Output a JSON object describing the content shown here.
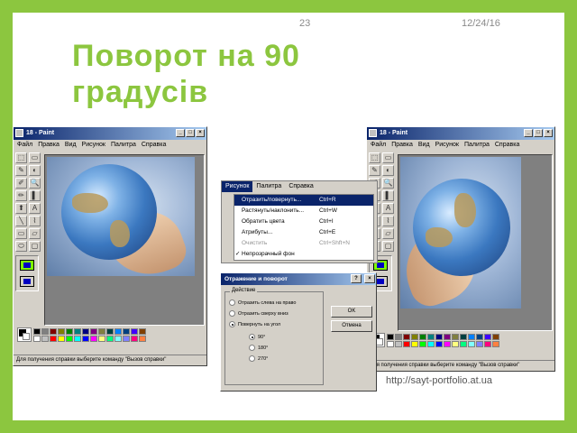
{
  "slide": {
    "number": "23",
    "date": "12/24/16",
    "title_line1": "Поворот на 90",
    "title_line2": "градусів",
    "url": "http://sayt-portfolio.at.ua"
  },
  "paint_left": {
    "title": "18 - Paint",
    "menu": [
      "Файл",
      "Правка",
      "Вид",
      "Рисунок",
      "Палитра",
      "Справка"
    ],
    "status": "Для получения справки выберите команду \"Вызов справки\""
  },
  "paint_right": {
    "title": "18 - Paint",
    "menu": [
      "Файл",
      "Правка",
      "Вид",
      "Рисунок",
      "Палитра",
      "Справка"
    ],
    "status": "Для получения справки выберите команду \"Вызов справки\""
  },
  "window_buttons": {
    "minimize": "_",
    "maximize": "□",
    "close": "×"
  },
  "tool_glyphs": [
    "⬚",
    "▭",
    "✎",
    "◐",
    "✐",
    "🔍",
    "✏",
    "▌",
    "⬆",
    "A",
    "╲",
    "⌇",
    "▭",
    "▱",
    "⬭",
    "▢"
  ],
  "palette_colors": [
    "#000000",
    "#808080",
    "#800000",
    "#808000",
    "#008000",
    "#008080",
    "#000080",
    "#800080",
    "#808040",
    "#004040",
    "#0080ff",
    "#004080",
    "#4000ff",
    "#804000",
    "#ffffff",
    "#c0c0c0",
    "#ff0000",
    "#ffff00",
    "#00ff00",
    "#00ffff",
    "#0000ff",
    "#ff00ff",
    "#ffff80",
    "#00ff80",
    "#80ffff",
    "#8080ff",
    "#ff0080",
    "#ff8040"
  ],
  "image_menu": {
    "tabs": [
      "Рисунок",
      "Палитра",
      "Справка"
    ],
    "items": [
      {
        "label": "Отразить/повернуть...",
        "shortcut": "Ctrl+R",
        "selected": true
      },
      {
        "label": "Растянуть/наклонить...",
        "shortcut": "Ctrl+W"
      },
      {
        "label": "Обратить цвета",
        "shortcut": "Ctrl+I"
      },
      {
        "label": "Атрибуты...",
        "shortcut": "Ctrl+E"
      },
      {
        "label": "Очистить",
        "shortcut": "Ctrl+Shft+N",
        "disabled": true
      },
      {
        "label": "Непрозрачный фон",
        "shortcut": "",
        "checked": true
      }
    ]
  },
  "rotate_dialog": {
    "title": "Отражение и поворот",
    "help": "?",
    "close": "×",
    "group_label": "Действие",
    "options": [
      {
        "label": "Отразить слева на право",
        "checked": false
      },
      {
        "label": "Отразить сверху вниз",
        "checked": false
      },
      {
        "label": "Повернуть на угол",
        "checked": true
      }
    ],
    "angles": [
      {
        "label": "90°",
        "checked": true
      },
      {
        "label": "180°",
        "checked": false
      },
      {
        "label": "270°",
        "checked": false
      }
    ],
    "ok": "OK",
    "cancel": "Отмена"
  }
}
